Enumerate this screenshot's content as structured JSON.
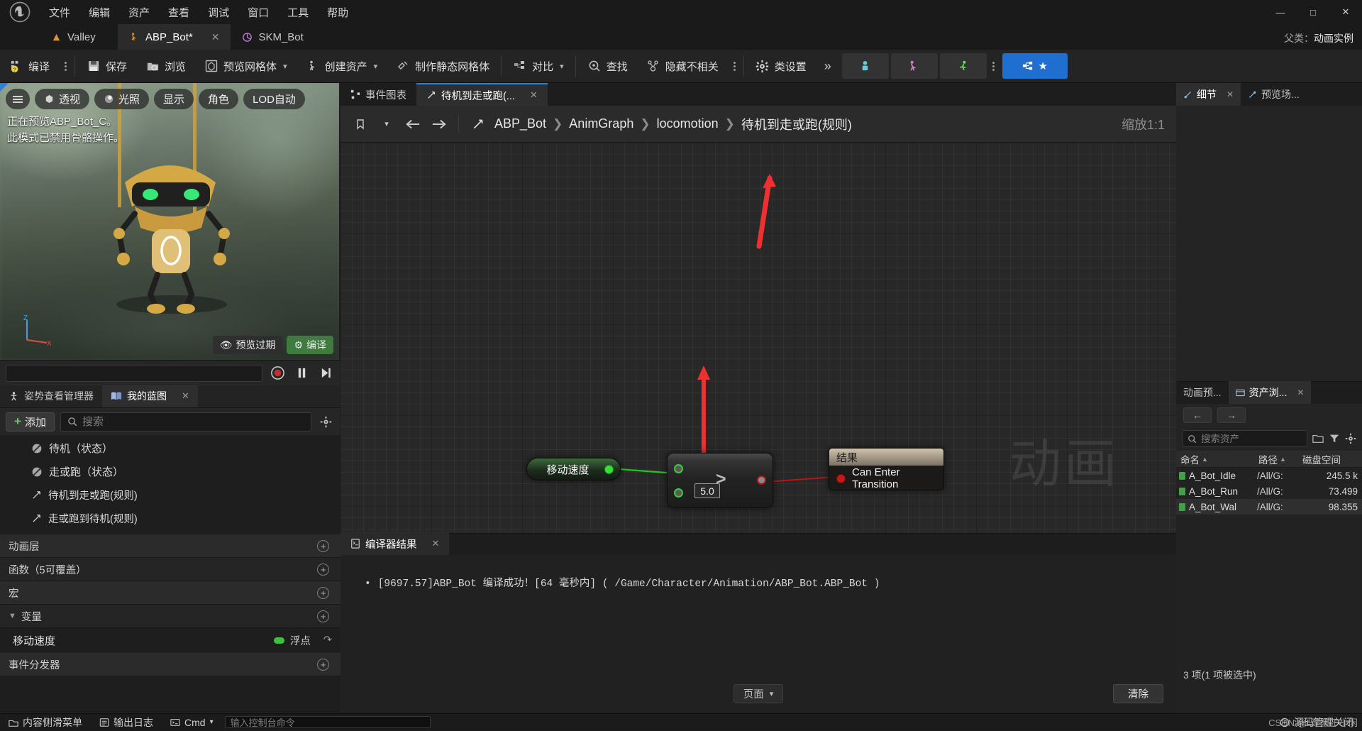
{
  "window": {
    "menu": [
      "文件",
      "编辑",
      "资产",
      "查看",
      "调试",
      "窗口",
      "工具",
      "帮助"
    ],
    "controls": {
      "minimize": "—",
      "maximize": "□",
      "close": "✕"
    }
  },
  "tabs": [
    {
      "label": "Valley",
      "icon": "mountain-icon",
      "active": false
    },
    {
      "label": "ABP_Bot*",
      "icon": "anim-blueprint-icon",
      "active": true,
      "closable": "✕"
    },
    {
      "label": "SKM_Bot",
      "icon": "skeletal-mesh-icon",
      "active": false
    }
  ],
  "parent_info": {
    "label": "父类：",
    "value": "动画实例"
  },
  "toolbar": {
    "compile": "编译",
    "save": "保存",
    "browse": "浏览",
    "preview_mesh": "预览网格体",
    "create_asset": "创建资产",
    "make_static_mesh": "制作静态网格体",
    "diff": "对比",
    "find": "查找",
    "hide_unrelated": "隐藏不相关",
    "class_settings": "类设置",
    "overflow": "»"
  },
  "viewport": {
    "chips": [
      "透视",
      "光照",
      "显示",
      "角色",
      "LOD自动"
    ],
    "menu_icon": "hamburger-icon",
    "play_icon": "play-icon",
    "status_line1": "正在预览ABP_Bot_C。",
    "status_line2": "此模式已禁用骨骼操作。",
    "axis": {
      "z": "Z",
      "x": "X"
    },
    "btn_preview_outdated": "预览过期",
    "btn_compile": "编译"
  },
  "left_panel": {
    "tabs": [
      {
        "label": "姿势查看管理器",
        "icon": "pose-watch-icon",
        "active": false
      },
      {
        "label": "我的蓝图",
        "icon": "blueprint-book-icon",
        "active": true,
        "closable": "✕"
      }
    ],
    "add_button": "添加",
    "search_placeholder": "搜索",
    "search_value": "",
    "tree_items": [
      {
        "label": "待机（状态）",
        "icon": "state-icon"
      },
      {
        "label": "走或跑（状态）",
        "icon": "state-icon"
      },
      {
        "label": "待机到走或跑(规则)",
        "icon": "transition-icon"
      },
      {
        "label": "走或跑到待机(规则)",
        "icon": "transition-icon"
      }
    ],
    "categories": [
      {
        "label": "动画层",
        "add": "+"
      },
      {
        "label": "函数（5可覆盖）",
        "add": "+"
      },
      {
        "label": "宏",
        "add": "+"
      },
      {
        "label": "变量",
        "add": "+",
        "expanded": true
      }
    ],
    "variables": [
      {
        "name": "移动速度",
        "type": "浮点",
        "type_color": "#3fc13f"
      }
    ],
    "event_dispatchers": {
      "label": "事件分发器",
      "add": "+"
    }
  },
  "graph": {
    "tabs": [
      {
        "label": "事件图表",
        "icon": "event-graph-icon",
        "active": false
      },
      {
        "label": "待机到走或跑(...",
        "icon": "transition-icon",
        "active": true,
        "closable": "✕"
      }
    ],
    "breadcrumb": [
      "ABP_Bot",
      "AnimGraph",
      "locomotion",
      "待机到走或跑(规则)"
    ],
    "breadcrumb_sep": "❯",
    "zoom_label": "缩放1:1",
    "watermark": "动画",
    "nodes": {
      "variable": {
        "title": "移动速度",
        "pin": "output"
      },
      "compare": {
        "operator": ">",
        "default_value": "5.0"
      },
      "result": {
        "title": "结果",
        "pin_label": "Can Enter Transition"
      }
    }
  },
  "compiler_results": {
    "tab_label": "编译器结果",
    "tab_close": "✕",
    "messages": [
      "[9697.57]ABP_Bot 编译成功！[64 毫秒内] ( /Game/Character/Animation/ABP_Bot.ABP_Bot )"
    ],
    "page_button": "页面",
    "clear_button": "清除"
  },
  "right_panel": {
    "tabs": [
      {
        "label": "细节",
        "icon": "details-icon",
        "active": true,
        "closable": "✕"
      },
      {
        "label": "预览场...",
        "icon": "preview-scene-icon",
        "active": false
      }
    ],
    "tabs2": [
      {
        "label": "动画预...",
        "icon": "anim-preview-icon",
        "active": false
      },
      {
        "label": "资产浏...",
        "icon": "asset-browser-icon",
        "active": true,
        "closable": "✕"
      }
    ],
    "nav": {
      "back": "←",
      "forward": "→"
    },
    "search_placeholder": "搜索资产",
    "search_value": "",
    "columns": [
      "命名",
      "路径",
      "磁盘空间"
    ],
    "sort_indicator": "▲",
    "assets": [
      {
        "name": "A_Bot_Idle",
        "path": "/All/G:",
        "size": "245.5 k",
        "selected": false
      },
      {
        "name": "A_Bot_Run",
        "path": "/All/G:",
        "size": "73.499",
        "selected": false
      },
      {
        "name": "A_Bot_Wal",
        "path": "/All/G:",
        "size": "98.355",
        "selected": true
      }
    ],
    "status": "3 项(1 项被选中)"
  },
  "bottom_bar": {
    "content_drawer": "内容侧滑菜单",
    "output_log": "输出日志",
    "cmd_label": "Cmd",
    "cmd_placeholder": "输入控制台命令",
    "right_label": "源码管理关闭"
  },
  "watermark_text": "CSDN @L建豪于小闲",
  "colors": {
    "accent_blue": "#1f6fd0",
    "green": "#3fc13f",
    "red": "#c21a1a",
    "anno_red": "#f03030"
  }
}
